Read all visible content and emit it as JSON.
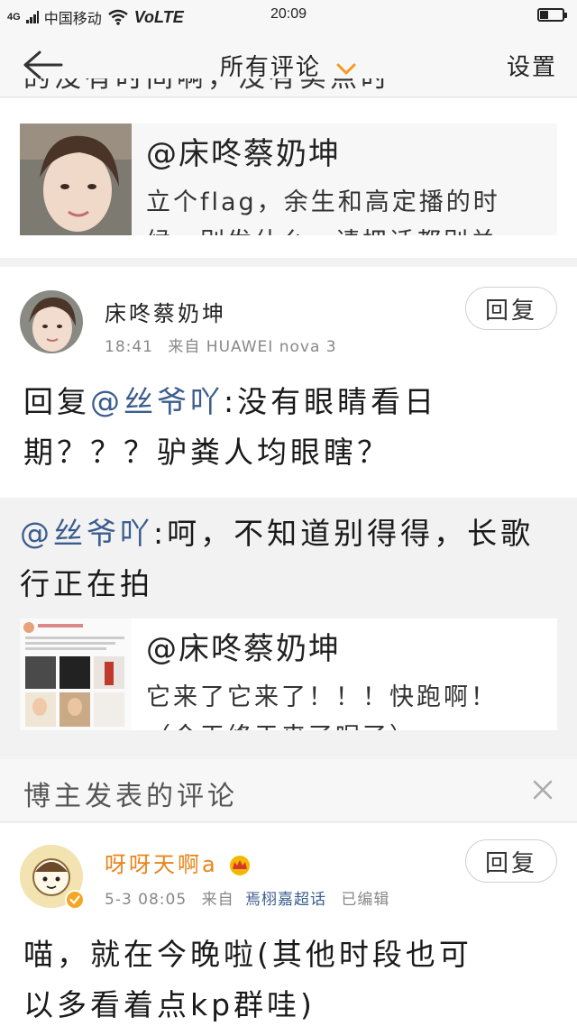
{
  "status": {
    "signal_tag": "4G",
    "carrier": "中国移动",
    "volte": "VoLTE",
    "time": "20:09"
  },
  "nav": {
    "title": "所有评论",
    "settings": "设置"
  },
  "partial_top_text": "的没有时间啊，没有实点时",
  "quote1": {
    "name": "@床咚蔡奶坤",
    "text": "立个flag，余生和高定播的时",
    "text2": "候，别发什么，请把话都别关"
  },
  "comment": {
    "username": "床咚蔡奶坤",
    "time": "18:41",
    "source": "来自 HUAWEI nova 3",
    "reply_label": "回复",
    "body_prefix": "回复",
    "body_mention": "@丝爷吖",
    "body_line1_rest": ":没有眼睛看日",
    "body_line2": "期？？？驴粪人均眼瞎？"
  },
  "repost": {
    "mention": "@丝爷吖",
    "line1_rest": ":呵，不知道别得得，长歌",
    "line2": "行正在拍",
    "quote_name": "@床咚蔡奶坤",
    "quote_text": "它来了它来了！！！快跑啊！",
    "quote_text2": "（今天终于来了呢了）"
  },
  "section": {
    "label": "博主发表的评论"
  },
  "blogger_comment": {
    "username": "呀呀天啊a",
    "time": "5-3 08:05",
    "source_prefix": "来自",
    "source_topic": "焉栩嘉超话",
    "edited": "已编辑",
    "reply_label": "回复",
    "body_line1": "喵，就在今晚啦(其他时段也可",
    "body_line2": "以多看着点kp群哇)"
  },
  "colors": {
    "accent_orange": "#f59a23",
    "mention_blue": "#3b5d8e",
    "username_orange": "#e8841a"
  }
}
